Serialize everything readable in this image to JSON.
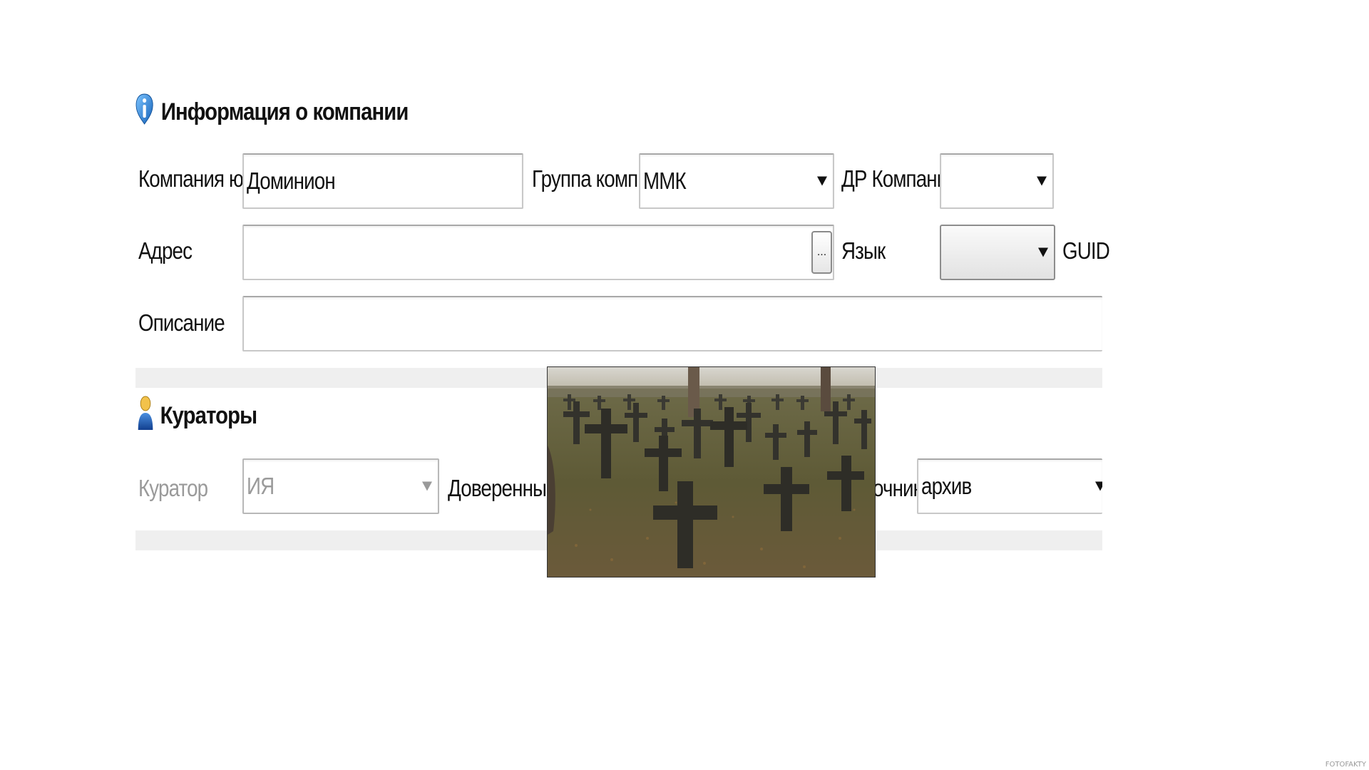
{
  "company_section": {
    "title": "Информация о компании",
    "icon": "info-icon",
    "company_legal_label": "Компания юр.",
    "company_legal_value": "Доминион",
    "group_label": "Группа комп.",
    "group_value": "ММК",
    "birthday_label": "ДР Компании",
    "birthday_value": "",
    "address_label": "Адрес",
    "address_value": "",
    "address_button": "...",
    "language_label": "Язык",
    "language_value": "",
    "guid_label": "GUID",
    "description_label": "Описание",
    "description_value": ""
  },
  "curators_section": {
    "title": "Кураторы",
    "icon": "user-icon",
    "curator_label": "Куратор",
    "curator_value": "ИЯ",
    "trusted_label": "Доверенные к",
    "source_label": "очник",
    "source_value": "архив"
  },
  "overlay_photo": {
    "subject": "cemetery with wooden crosses"
  },
  "watermark": "FOTOFAKTY",
  "colors": {
    "icon_blue": "#1f7fd6",
    "band_grey": "#efefef",
    "disabled_text": "#9a9a9a"
  }
}
